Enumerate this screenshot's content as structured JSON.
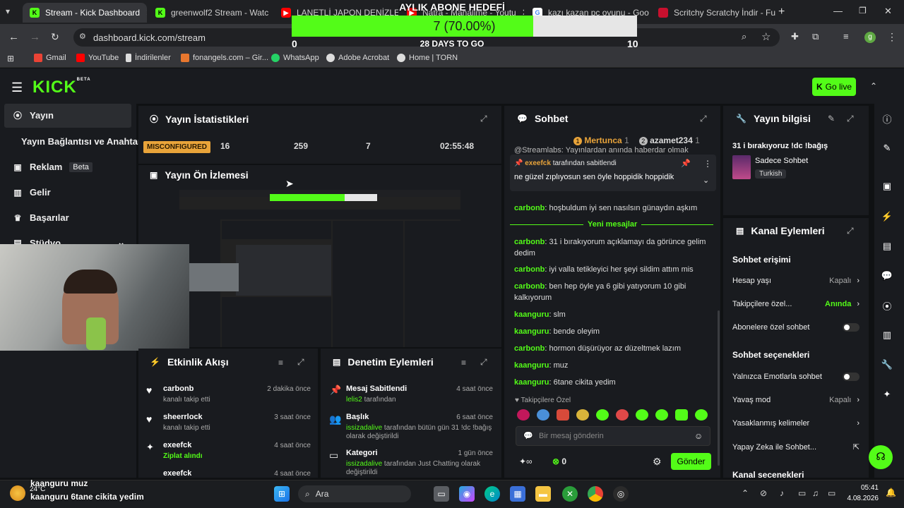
{
  "browser": {
    "tabs": [
      {
        "label": "Stream - Kick Dashboard",
        "active": true,
        "icon": "kick-icon",
        "color": "#53fc18"
      },
      {
        "label": "greenwolf2 Stream - Watc",
        "icon": "kick-icon",
        "color": "#53fc18"
      },
      {
        "label": "LANETLİ JAPON DENİZLER",
        "icon": "youtube-icon",
        "color": "#ff0000"
      },
      {
        "label": "Natra - Mahallme - Youtu",
        "icon": "youtube-icon",
        "color": "#ff0000"
      },
      {
        "label": "kazı kazan pc oyunu - Goo",
        "icon": "google-icon",
        "color": "#ffffff"
      },
      {
        "label": "Scritchy Scratchy İndir - Fu",
        "icon": "site-icon",
        "color": "#c8102e"
      }
    ],
    "url": "dashboard.kick.com/stream",
    "bookmarks": [
      {
        "label": "Gmail",
        "color": "#ea4335"
      },
      {
        "label": "YouTube",
        "color": "#ff0000"
      },
      {
        "label": "İndirilenler",
        "color": "#dddddd"
      },
      {
        "label": "fonangels.com – Gir...",
        "color": "#e8772e"
      },
      {
        "label": "WhatsApp",
        "color": "#25d366"
      },
      {
        "label": "Adobe Acrobat",
        "color": "#dddddd"
      },
      {
        "label": "Home | TORN",
        "color": "#dddddd"
      }
    ],
    "profile_initial": "g"
  },
  "goal_overlay": {
    "title": "AYLIK ABONE HEDEFİ",
    "progress_text": "7 (70.00%)",
    "progress_fraction": 0.7,
    "min": "0",
    "max": "10",
    "subtitle": "28 DAYS TO GO"
  },
  "kick": {
    "logo": "KICK",
    "beta": "BETA",
    "go_live": "Go live"
  },
  "sidebar": {
    "items": [
      {
        "label": "Yayın",
        "icon": "broadcast-icon"
      },
      {
        "label": "Yayın Bağlantısı ve Anahtarı",
        "icon": ""
      },
      {
        "label": "Reklam",
        "icon": "ad-icon",
        "badge": "Beta"
      },
      {
        "label": "Gelir",
        "icon": "chart-icon"
      },
      {
        "label": "Başarılar",
        "icon": "trophy-icon"
      },
      {
        "label": "Stüdyo",
        "icon": "studio-icon"
      }
    ]
  },
  "stats": {
    "title": "Yayın İstatistikleri",
    "status": "MISCONFIGURED",
    "values": [
      "16",
      "259",
      "7",
      "02:55:48"
    ]
  },
  "preview": {
    "title": "Yayın Ön İzlemesi"
  },
  "activity": {
    "title": "Etkinlik Akışı",
    "items": [
      {
        "name": "carbonb",
        "sub": "kanalı takip etti",
        "time": "2 dakika önce",
        "icon": "heart-icon"
      },
      {
        "name": "sheerrlock",
        "sub": "kanalı takip etti",
        "time": "3 saat önce",
        "icon": "heart-icon"
      },
      {
        "name": "exeefck",
        "sub": "Ziplat alındı",
        "time": "4 saat önce",
        "icon": "kick-icon"
      },
      {
        "name": "exeefck",
        "sub": "",
        "time": "4 saat önce",
        "icon": "kick-icon"
      }
    ]
  },
  "moderation": {
    "title": "Denetim Eylemleri",
    "items": [
      {
        "name": "Mesaj Sabitlendi",
        "user": "lelis2",
        "rest": "tarafından",
        "time": "4 saat önce"
      },
      {
        "name": "Başlık",
        "user": "issizadalive",
        "rest": "tarafından bütün gün 31 !dc !bağış olarak değiştirildi",
        "time": "6 saat önce"
      },
      {
        "name": "Kategori",
        "user": "issizadalive",
        "rest": "tarafından Just Chatting olarak değiştirildi",
        "time": "1 gün önce"
      }
    ]
  },
  "chat": {
    "title": "Sohbet",
    "leaders": [
      {
        "rank": "1",
        "name": "Mertunca",
        "score": "1"
      },
      {
        "rank": "2",
        "name": "azamet234",
        "score": "1"
      }
    ],
    "pinned_user": "exeefck",
    "pinned_label": "tarafından sabitlendi",
    "pinned_text": "ne güzel zıplıyosun sen öyle hoppidik hoppidik",
    "top_partial": "@Streamlabs: Yayınlardan anında haberdar olmak",
    "messages": [
      {
        "user": "carbonb",
        "text": "hoşbuldum iyi sen nasılsın günaydın aşkım"
      },
      {
        "user": "carbonb",
        "text": "31 i bırakıyorum açıklamayı da görünce gelim dedim"
      },
      {
        "user": "carbonb",
        "text": "iyi valla tetikleyici her şeyi sildim attım mis"
      },
      {
        "user": "carbonb",
        "text": "ben hep öyle ya 6 gibi yatıyorum 10 gibi kalkıyorum"
      },
      {
        "user": "kaanguru",
        "text": "slm"
      },
      {
        "user": "kaanguru",
        "text": "bende oleyim"
      },
      {
        "user": "carbonb",
        "text": "hormon düşürüyor az düzeltmek lazım"
      },
      {
        "user": "kaanguru",
        "text": "muz"
      },
      {
        "user": "kaanguru",
        "text": "6tane cikita yedim"
      }
    ],
    "new_messages": "Yeni mesajlar",
    "followers_only": "Takipçilere Özel",
    "input_placeholder": "Bir mesaj gönderin",
    "points": "0",
    "send": "Gönder"
  },
  "stream_info": {
    "title": "Yayın bilgisi",
    "stream_title": "31 i bırakıyoruz !dc !bağış",
    "category": "Sadece Sohbet",
    "language": "Turkish"
  },
  "channel_actions": {
    "title": "Kanal Eylemleri",
    "chat_access": "Sohbet erişimi",
    "account_age": {
      "label": "Hesap yaşı",
      "value": "Kapalı"
    },
    "followers_only": {
      "label": "Takipçilere özel...",
      "value": "Anında"
    },
    "subscribers_only": {
      "label": "Abonelere özel sohbet"
    },
    "chat_options": "Sohbet seçenekleri",
    "emotes_only": {
      "label": "Yalnızca Emotlarla sohbet"
    },
    "slow_mode": {
      "label": "Yavaş mod",
      "value": "Kapalı"
    },
    "banned_words": {
      "label": "Yasaklanmış kelimeler"
    },
    "ai_chat": {
      "label": "Yapay Zeka ile Sohbet..."
    },
    "channel_options_partial": "Kanal seçenekleri"
  },
  "overlay_chat": [
    {
      "user": "kaanguru",
      "text": "muz"
    },
    {
      "user": "kaanguru",
      "text": "6tane cikita yedim"
    }
  ],
  "taskbar": {
    "weather": "24°C",
    "search": "Ara",
    "time": "05:41",
    "date": "4.08.2026"
  }
}
